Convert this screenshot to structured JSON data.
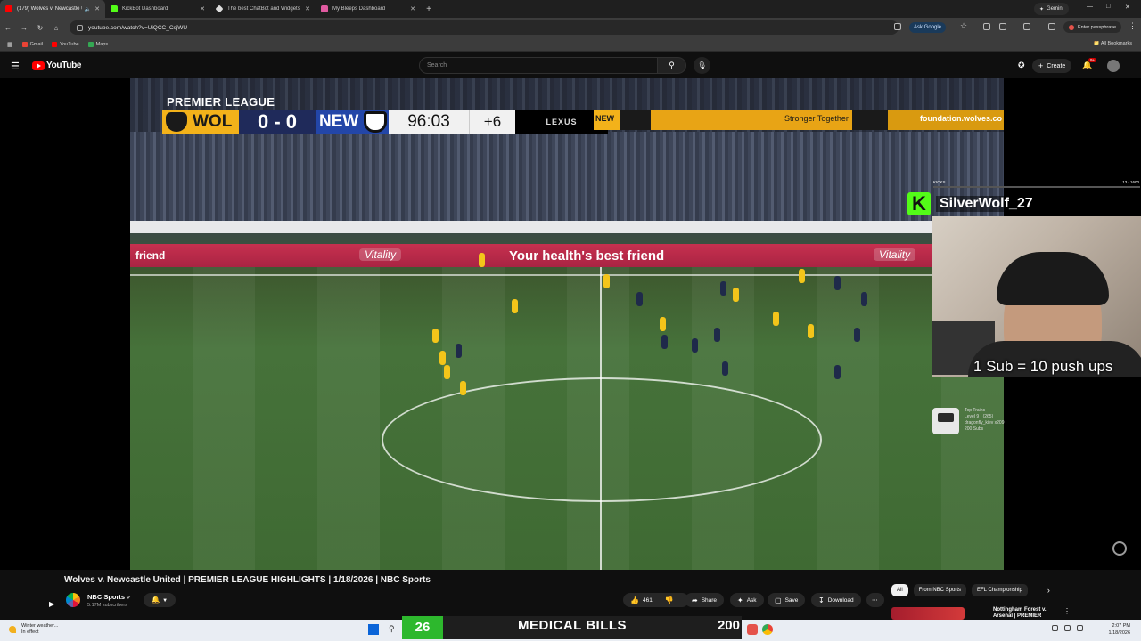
{
  "browser": {
    "tabs": [
      {
        "title": "(179) Wolves v. Newcastle U",
        "favicon": "youtube-favicon",
        "color": "#ff0000",
        "active": true
      },
      {
        "title": "KickBot Dashboard",
        "favicon": "kickbot-favicon",
        "color": "#53fc18",
        "active": false
      },
      {
        "title": "The best ChatBot and Widgets",
        "favicon": "diamond-favicon",
        "color": "#dddddd",
        "active": false
      },
      {
        "title": "My Bleeps Dashboard",
        "favicon": "bleeps-favicon",
        "color": "#e05aa0",
        "active": false
      }
    ],
    "gemini_label": "Gemini",
    "url": "youtube.com/watch?v=UiQCC_CsjWU",
    "ask_google_label": "Ask Google",
    "passphrase_label": "Enter passphrase",
    "bookmarks": [
      {
        "label": "Gmail",
        "color": "#ea4335"
      },
      {
        "label": "YouTube",
        "color": "#ff0000"
      },
      {
        "label": "Maps",
        "color": "#34a853"
      }
    ],
    "all_bookmarks_label": "All Bookmarks"
  },
  "youtube": {
    "logo_text": "YouTube",
    "search_placeholder": "Search",
    "create_label": "Create",
    "notification_count": "9+"
  },
  "broadcast": {
    "league_label": "PREMIER LEAGUE",
    "home_team": "WOL",
    "away_team": "NEW",
    "score": "0 - 0",
    "clock": "96:03",
    "added_time": "+6",
    "sponsor": "LEXUS",
    "ad_main": "Your health's best friend",
    "ad_left": "friend",
    "ad_logo": "Vitality",
    "led_new": "NEW",
    "led_text": "Stronger Together",
    "led_url": "foundation.wolves.co"
  },
  "stream_overlay": {
    "kicks_label": "KICKS",
    "kicks_progress": "13 / 1600",
    "username": "SilverWolf_27",
    "sub_goal_text": "1 Sub = 10 push ups",
    "train_lines": [
      "Top Trains",
      "Level 9 · (265)",
      "dragonfly_kiev x209",
      "200 Subs"
    ]
  },
  "video": {
    "title": "Wolves v. Newcastle United | PREMIER LEAGUE HIGHLIGHTS | 1/18/2026 | NBC Sports",
    "channel_name": "NBC Sports",
    "subscribers": "5.17M subscribers",
    "like_count": "461",
    "actions": {
      "share": "Share",
      "ask": "Ask",
      "save": "Save",
      "download": "Download"
    }
  },
  "sidebar": {
    "chips": [
      "All",
      "From NBC Sports",
      "EFL Championship"
    ],
    "rec_title_line1": "Nottingham Forest v.",
    "rec_title_line2": "Arsenal | PREMIER"
  },
  "taskbar": {
    "weather_title": "Winter weather...",
    "weather_sub": "In effect",
    "stream_left": "26",
    "stream_mid": "MEDICAL BILLS",
    "stream_right": "200",
    "time": "2:07 PM",
    "date": "1/18/2026"
  }
}
